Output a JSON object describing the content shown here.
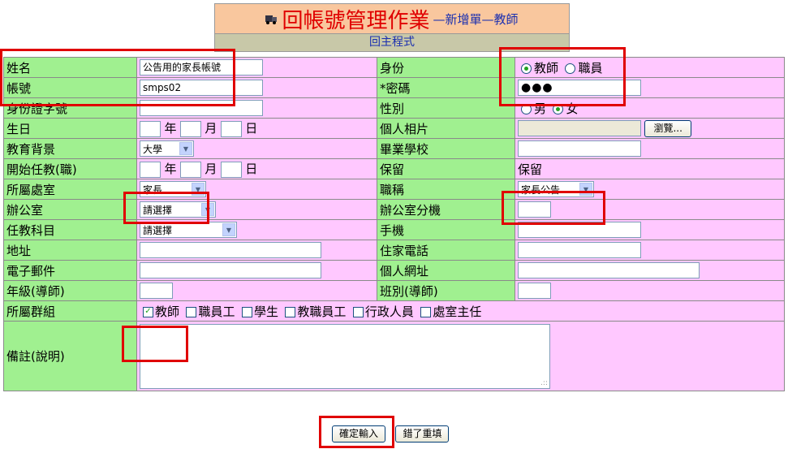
{
  "header": {
    "title": "回帳號管理作業",
    "subtitle": "—新增單—教師",
    "back_link": "回主程式"
  },
  "form": {
    "name_label": "姓名",
    "name_value": "公告用的家長帳號",
    "identity_label": "身份",
    "identity_options": [
      "教師",
      "職員"
    ],
    "identity_selected": "教師",
    "account_label": "帳號",
    "account_value": "smps02",
    "password_label": "*密碼",
    "password_value": "●●●",
    "id_label": "身份證字號",
    "gender_label": "性別",
    "gender_options": [
      "男",
      "女"
    ],
    "gender_selected": "女",
    "birthday_label": "生日",
    "date_year": "年",
    "date_month": "月",
    "date_day": "日",
    "photo_label": "個人相片",
    "browse_label": "瀏覽...",
    "education_label": "教育背景",
    "education_value": "大學",
    "school_label": "畢業學校",
    "start_label": "開始任教(職)",
    "reserved_label": "保留",
    "reserved_value": "保留",
    "office_label": "所屬處室",
    "office_value": "家長",
    "title_label": "職稱",
    "title_value": "家長公告",
    "room_label": "辦公室",
    "room_value": "請選擇",
    "ext_label": "辦公室分機",
    "subject_label": "任教科目",
    "subject_value": "請選擇",
    "mobile_label": "手機",
    "address_label": "地址",
    "home_phone_label": "住家電話",
    "email_label": "電子郵件",
    "website_label": "個人網址",
    "grade_label": "年級(導師)",
    "class_label": "班別(導師)",
    "group_label": "所屬群組",
    "groups": [
      {
        "label": "教師",
        "checked": true
      },
      {
        "label": "職員工",
        "checked": false
      },
      {
        "label": "學生",
        "checked": false
      },
      {
        "label": "教職員工",
        "checked": false
      },
      {
        "label": "行政人員",
        "checked": false
      },
      {
        "label": "處室主任",
        "checked": false
      }
    ],
    "note_label": "備註(說明)"
  },
  "buttons": {
    "submit": "確定輸入",
    "reset": "錯了重填"
  },
  "colors": {
    "label_bg": "#a0f090",
    "value_bg": "#ffc8ff",
    "header_bg": "#f9c79e",
    "highlight": "#e00000"
  }
}
